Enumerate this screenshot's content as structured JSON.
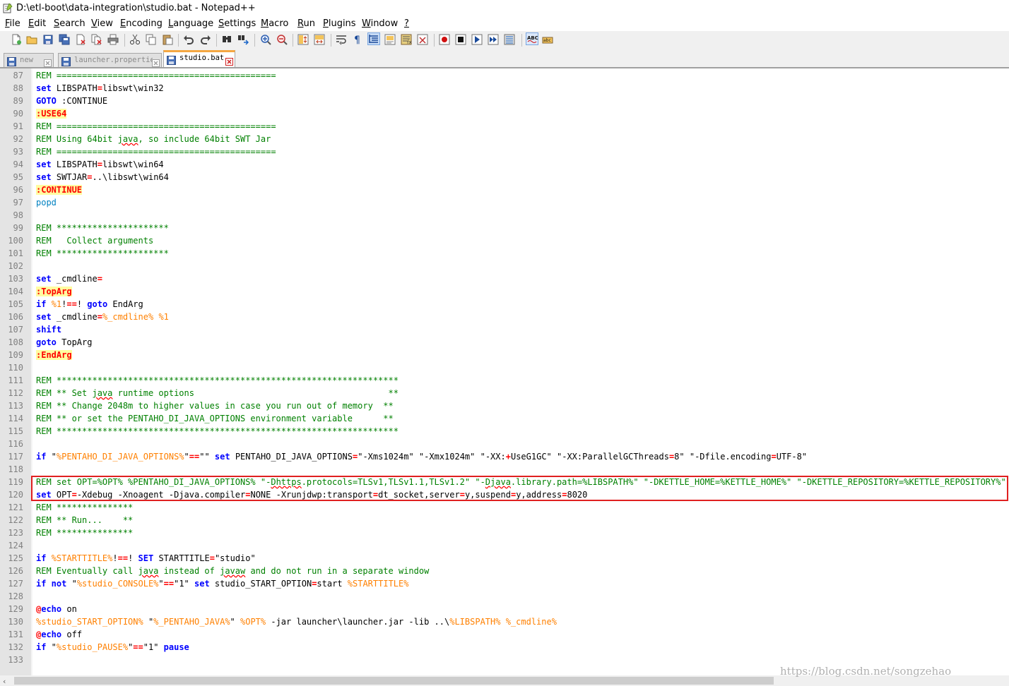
{
  "window": {
    "title": "D:\\etl-boot\\data-integration\\studio.bat - Notepad++",
    "icon": "notepad-plus-plus-icon"
  },
  "menubar": {
    "items": [
      {
        "label": "File",
        "name": "menu-file"
      },
      {
        "label": "Edit",
        "name": "menu-edit"
      },
      {
        "label": "Search",
        "name": "menu-search"
      },
      {
        "label": "View",
        "name": "menu-view"
      },
      {
        "label": "Encoding",
        "name": "menu-encoding"
      },
      {
        "label": "Language",
        "name": "menu-language"
      },
      {
        "label": "Settings",
        "name": "menu-settings"
      },
      {
        "label": "Macro",
        "name": "menu-macro"
      },
      {
        "label": "Run",
        "name": "menu-run"
      },
      {
        "label": "Plugins",
        "name": "menu-plugins"
      },
      {
        "label": "Window",
        "name": "menu-window"
      },
      {
        "label": "?",
        "name": "menu-help"
      }
    ]
  },
  "toolbar": {
    "icons": [
      "new-file-icon",
      "open-file-icon",
      "save-icon",
      "save-all-icon",
      "close-icon",
      "close-all-icon",
      "print-icon",
      "cut-icon",
      "copy-icon",
      "paste-icon",
      "undo-icon",
      "redo-icon",
      "find-icon",
      "replace-icon",
      "zoom-in-icon",
      "zoom-out-icon",
      "sync-vertical-icon",
      "sync-horizontal-icon",
      "word-wrap-icon",
      "show-all-chars-icon",
      "indent-guide-icon",
      "document-map-icon",
      "function-list-icon",
      "folder-workspace-icon",
      "record-macro-icon",
      "stop-macro-icon",
      "play-macro-icon",
      "run-macro-multiple-icon",
      "save-macro-icon",
      "spell-check-icon",
      "spell-check-options-icon"
    ]
  },
  "tabs": [
    {
      "label": "new",
      "active": false,
      "icon": "saved-file-icon"
    },
    {
      "label": "launcher.properties",
      "active": false,
      "icon": "saved-file-icon"
    },
    {
      "label": "studio.bat",
      "active": true,
      "icon": "saved-file-icon"
    }
  ],
  "editor": {
    "lines": [
      {
        "n": "87",
        "tokens": [
          {
            "t": "REM ===========================================",
            "c": "c"
          }
        ]
      },
      {
        "n": "88",
        "tokens": [
          {
            "t": "set",
            "c": "k"
          },
          {
            "t": " LIBSPATH",
            "c": ""
          },
          {
            "t": "=",
            "c": "o"
          },
          {
            "t": "libswt\\win32",
            "c": ""
          }
        ]
      },
      {
        "n": "89",
        "tokens": [
          {
            "t": "GOTO",
            "c": "k"
          },
          {
            "t": " :CONTINUE",
            "c": ""
          }
        ]
      },
      {
        "n": "90",
        "tokens": [
          {
            "t": ":USE64",
            "c": "lbl"
          }
        ]
      },
      {
        "n": "91",
        "tokens": [
          {
            "t": "REM ===========================================",
            "c": "c"
          }
        ]
      },
      {
        "n": "92",
        "tokens": [
          {
            "t": "REM Using 64bit ",
            "c": "c"
          },
          {
            "t": "java",
            "c": "c sq"
          },
          {
            "t": ", so include 64bit SWT Jar",
            "c": "c"
          }
        ]
      },
      {
        "n": "93",
        "tokens": [
          {
            "t": "REM ===========================================",
            "c": "c"
          }
        ]
      },
      {
        "n": "94",
        "tokens": [
          {
            "t": "set",
            "c": "k"
          },
          {
            "t": " LIBSPATH",
            "c": ""
          },
          {
            "t": "=",
            "c": "o"
          },
          {
            "t": "libswt\\win64",
            "c": ""
          }
        ]
      },
      {
        "n": "95",
        "tokens": [
          {
            "t": "set",
            "c": "k"
          },
          {
            "t": " SWTJAR",
            "c": ""
          },
          {
            "t": "=",
            "c": "o"
          },
          {
            "t": "..\\libswt\\win64",
            "c": ""
          }
        ]
      },
      {
        "n": "96",
        "tokens": [
          {
            "t": ":CONTINUE",
            "c": "lbl"
          }
        ]
      },
      {
        "n": "97",
        "tokens": [
          {
            "t": "popd",
            "c": "pl"
          }
        ]
      },
      {
        "n": "98",
        "tokens": []
      },
      {
        "n": "99",
        "tokens": [
          {
            "t": "REM **********************",
            "c": "c"
          }
        ]
      },
      {
        "n": "100",
        "tokens": [
          {
            "t": "REM   Collect arguments",
            "c": "c"
          }
        ]
      },
      {
        "n": "101",
        "tokens": [
          {
            "t": "REM **********************",
            "c": "c"
          }
        ]
      },
      {
        "n": "102",
        "tokens": []
      },
      {
        "n": "103",
        "tokens": [
          {
            "t": "set",
            "c": "k"
          },
          {
            "t": " _cmdline",
            "c": ""
          },
          {
            "t": "=",
            "c": "o"
          }
        ]
      },
      {
        "n": "104",
        "tokens": [
          {
            "t": ":TopArg",
            "c": "lbl"
          }
        ]
      },
      {
        "n": "105",
        "tokens": [
          {
            "t": "if",
            "c": "k"
          },
          {
            "t": " ",
            "c": ""
          },
          {
            "t": "%1",
            "c": "v"
          },
          {
            "t": "!",
            "c": ""
          },
          {
            "t": "==",
            "c": "o"
          },
          {
            "t": "!",
            "c": ""
          },
          {
            "t": " goto",
            "c": "k"
          },
          {
            "t": " EndArg",
            "c": ""
          }
        ]
      },
      {
        "n": "106",
        "tokens": [
          {
            "t": "set",
            "c": "k"
          },
          {
            "t": " _cmdline",
            "c": ""
          },
          {
            "t": "=",
            "c": "o"
          },
          {
            "t": "%_cmdline%",
            "c": "v"
          },
          {
            "t": " ",
            "c": ""
          },
          {
            "t": "%1",
            "c": "v"
          }
        ]
      },
      {
        "n": "107",
        "tokens": [
          {
            "t": "shift",
            "c": "k"
          }
        ]
      },
      {
        "n": "108",
        "tokens": [
          {
            "t": "goto",
            "c": "k"
          },
          {
            "t": " TopArg",
            "c": ""
          }
        ]
      },
      {
        "n": "109",
        "tokens": [
          {
            "t": ":EndArg",
            "c": "lbl"
          }
        ]
      },
      {
        "n": "110",
        "tokens": []
      },
      {
        "n": "111",
        "tokens": [
          {
            "t": "REM *******************************************************************",
            "c": "c"
          }
        ]
      },
      {
        "n": "112",
        "tokens": [
          {
            "t": "REM ** Set ",
            "c": "c"
          },
          {
            "t": "java",
            "c": "c sq"
          },
          {
            "t": " runtime options                                      **",
            "c": "c"
          }
        ]
      },
      {
        "n": "113",
        "tokens": [
          {
            "t": "REM ** Change 2048m to higher values in case you run out of memory  **",
            "c": "c"
          }
        ]
      },
      {
        "n": "114",
        "tokens": [
          {
            "t": "REM ** or set the PENTAHO_DI_JAVA_OPTIONS environment variable      **",
            "c": "c"
          }
        ]
      },
      {
        "n": "115",
        "tokens": [
          {
            "t": "REM *******************************************************************",
            "c": "c"
          }
        ]
      },
      {
        "n": "116",
        "tokens": []
      },
      {
        "n": "117",
        "tokens": [
          {
            "t": "if",
            "c": "k"
          },
          {
            "t": " \"",
            "c": ""
          },
          {
            "t": "%PENTAHO_DI_JAVA_OPTIONS%",
            "c": "v"
          },
          {
            "t": "\"",
            "c": ""
          },
          {
            "t": "==",
            "c": "o"
          },
          {
            "t": "\"\" ",
            "c": ""
          },
          {
            "t": "set",
            "c": "k"
          },
          {
            "t": " PENTAHO_DI_JAVA_OPTIONS",
            "c": ""
          },
          {
            "t": "=",
            "c": "o"
          },
          {
            "t": "\"-Xms1024m\" \"-Xmx1024m\" \"-XX:",
            "c": ""
          },
          {
            "t": "+",
            "c": "o"
          },
          {
            "t": "UseG1GC\" \"-XX:ParallelGCThreads",
            "c": ""
          },
          {
            "t": "=",
            "c": "o"
          },
          {
            "t": "8\" \"-Dfile.encoding",
            "c": ""
          },
          {
            "t": "=",
            "c": "o"
          },
          {
            "t": "UTF-8\"",
            "c": ""
          }
        ]
      },
      {
        "n": "118",
        "tokens": []
      },
      {
        "n": "119",
        "tokens": [
          {
            "t": "REM set OPT=%OPT% %PENTAHO_DI_JAVA_OPTIONS% \"-",
            "c": "c"
          },
          {
            "t": "Dhttps",
            "c": "c sq"
          },
          {
            "t": ".protocols=TLSv1,TLSv1.1,TLSv1.2\" \"-",
            "c": "c"
          },
          {
            "t": "Djava",
            "c": "c sq"
          },
          {
            "t": ".library.path=%LIBSPATH%\" \"-DKETTLE_HOME=%KETTLE_HOME%\" \"-DKETTLE_REPOSITORY=%KETTLE_REPOSITORY%\"",
            "c": "c"
          }
        ]
      },
      {
        "n": "120",
        "tokens": [
          {
            "t": "set",
            "c": "k"
          },
          {
            "t": " OPT",
            "c": ""
          },
          {
            "t": "=",
            "c": "o"
          },
          {
            "t": "-Xdebug -Xnoagent -Djava.compiler",
            "c": ""
          },
          {
            "t": "=",
            "c": "o"
          },
          {
            "t": "NONE -Xrunjdwp:transport",
            "c": ""
          },
          {
            "t": "=",
            "c": "o"
          },
          {
            "t": "dt_socket,server",
            "c": ""
          },
          {
            "t": "=",
            "c": "o"
          },
          {
            "t": "y,suspend",
            "c": ""
          },
          {
            "t": "=",
            "c": "o"
          },
          {
            "t": "y,address",
            "c": ""
          },
          {
            "t": "=",
            "c": "o"
          },
          {
            "t": "8020",
            "c": ""
          }
        ]
      },
      {
        "n": "121",
        "tokens": [
          {
            "t": "REM ***************",
            "c": "c"
          }
        ]
      },
      {
        "n": "122",
        "tokens": [
          {
            "t": "REM ** Run...    **",
            "c": "c"
          }
        ]
      },
      {
        "n": "123",
        "tokens": [
          {
            "t": "REM ***************",
            "c": "c"
          }
        ]
      },
      {
        "n": "124",
        "tokens": []
      },
      {
        "n": "125",
        "tokens": [
          {
            "t": "if",
            "c": "k"
          },
          {
            "t": " ",
            "c": ""
          },
          {
            "t": "%STARTTITLE%",
            "c": "v"
          },
          {
            "t": "!",
            "c": ""
          },
          {
            "t": "==",
            "c": "o"
          },
          {
            "t": "!",
            "c": ""
          },
          {
            "t": " SET",
            "c": "k"
          },
          {
            "t": " STARTTITLE",
            "c": ""
          },
          {
            "t": "=",
            "c": "o"
          },
          {
            "t": "\"studio\"",
            "c": ""
          }
        ]
      },
      {
        "n": "126",
        "tokens": [
          {
            "t": "REM Eventually call ",
            "c": "c"
          },
          {
            "t": "java",
            "c": "c sq"
          },
          {
            "t": " instead of ",
            "c": "c"
          },
          {
            "t": "javaw",
            "c": "c sq"
          },
          {
            "t": " and do not run in a separate window",
            "c": "c"
          }
        ]
      },
      {
        "n": "127",
        "tokens": [
          {
            "t": "if",
            "c": "k"
          },
          {
            "t": " not",
            "c": "k"
          },
          {
            "t": " \"",
            "c": ""
          },
          {
            "t": "%studio_CONSOLE%",
            "c": "v"
          },
          {
            "t": "\"",
            "c": ""
          },
          {
            "t": "==",
            "c": "o"
          },
          {
            "t": "\"1\" ",
            "c": ""
          },
          {
            "t": "set",
            "c": "k"
          },
          {
            "t": " studio_START_OPTION",
            "c": ""
          },
          {
            "t": "=",
            "c": "o"
          },
          {
            "t": "start ",
            "c": ""
          },
          {
            "t": "%STARTTITLE%",
            "c": "v"
          }
        ]
      },
      {
        "n": "128",
        "tokens": []
      },
      {
        "n": "129",
        "tokens": [
          {
            "t": "@",
            "c": "o"
          },
          {
            "t": "echo",
            "c": "k"
          },
          {
            "t": " on",
            "c": ""
          }
        ]
      },
      {
        "n": "130",
        "tokens": [
          {
            "t": "%studio_START_OPTION%",
            "c": "v"
          },
          {
            "t": " \"",
            "c": ""
          },
          {
            "t": "%_PENTAHO_JAVA%",
            "c": "v"
          },
          {
            "t": "\" ",
            "c": ""
          },
          {
            "t": "%OPT%",
            "c": "v"
          },
          {
            "t": " -jar launcher\\launcher.jar -lib ..\\",
            "c": ""
          },
          {
            "t": "%LIBSPATH%",
            "c": "v"
          },
          {
            "t": " ",
            "c": ""
          },
          {
            "t": "%_cmdline%",
            "c": "v"
          }
        ]
      },
      {
        "n": "131",
        "tokens": [
          {
            "t": "@",
            "c": "o"
          },
          {
            "t": "echo",
            "c": "k"
          },
          {
            "t": " off",
            "c": ""
          }
        ]
      },
      {
        "n": "132",
        "tokens": [
          {
            "t": "if",
            "c": "k"
          },
          {
            "t": " \"",
            "c": ""
          },
          {
            "t": "%studio_PAUSE%",
            "c": "v"
          },
          {
            "t": "\"",
            "c": ""
          },
          {
            "t": "==",
            "c": "o"
          },
          {
            "t": "\"1\" ",
            "c": ""
          },
          {
            "t": "pause",
            "c": "k"
          }
        ]
      },
      {
        "n": "133",
        "tokens": []
      }
    ]
  },
  "scrollbar": {
    "left_arrow": "‹"
  },
  "watermark": "https://blog.csdn.net/songzehao",
  "colors": {
    "keyword": "#0000ff",
    "comment": "#008000",
    "variable": "#ff8000",
    "operator": "#ff0000",
    "label_bg": "#fffda0",
    "highlight_box": "#e02020"
  }
}
